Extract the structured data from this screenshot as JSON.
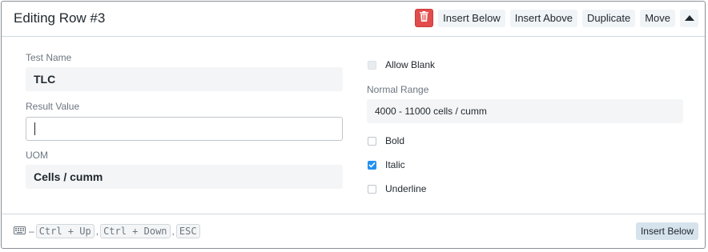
{
  "header": {
    "title": "Editing Row #3",
    "actions": {
      "delete_icon": "trash-icon",
      "insert_below": "Insert Below",
      "insert_above": "Insert Above",
      "duplicate": "Duplicate",
      "move": "Move",
      "collapse_icon": "caret-up-icon"
    }
  },
  "form": {
    "test_name": {
      "label": "Test Name",
      "value": "TLC"
    },
    "result_value": {
      "label": "Result Value",
      "value": ""
    },
    "uom": {
      "label": "UOM",
      "value": "Cells / cumm"
    },
    "allow_blank": {
      "label": "Allow Blank",
      "checked": false,
      "disabled": true
    },
    "normal_range": {
      "label": "Normal Range",
      "value": "4000 - 11000 cells / cumm"
    },
    "bold": {
      "label": "Bold",
      "checked": false
    },
    "italic": {
      "label": "Italic",
      "checked": true
    },
    "underline": {
      "label": "Underline",
      "checked": false
    }
  },
  "footer": {
    "keyboard_icon": "keyboard-icon",
    "dash": "–",
    "shortcuts": [
      "Ctrl + Up",
      "Ctrl + Down",
      "ESC"
    ],
    "separator": ",",
    "insert_below": "Insert Below"
  },
  "colors": {
    "danger": "#e24c4c",
    "accent": "#2490ef"
  }
}
